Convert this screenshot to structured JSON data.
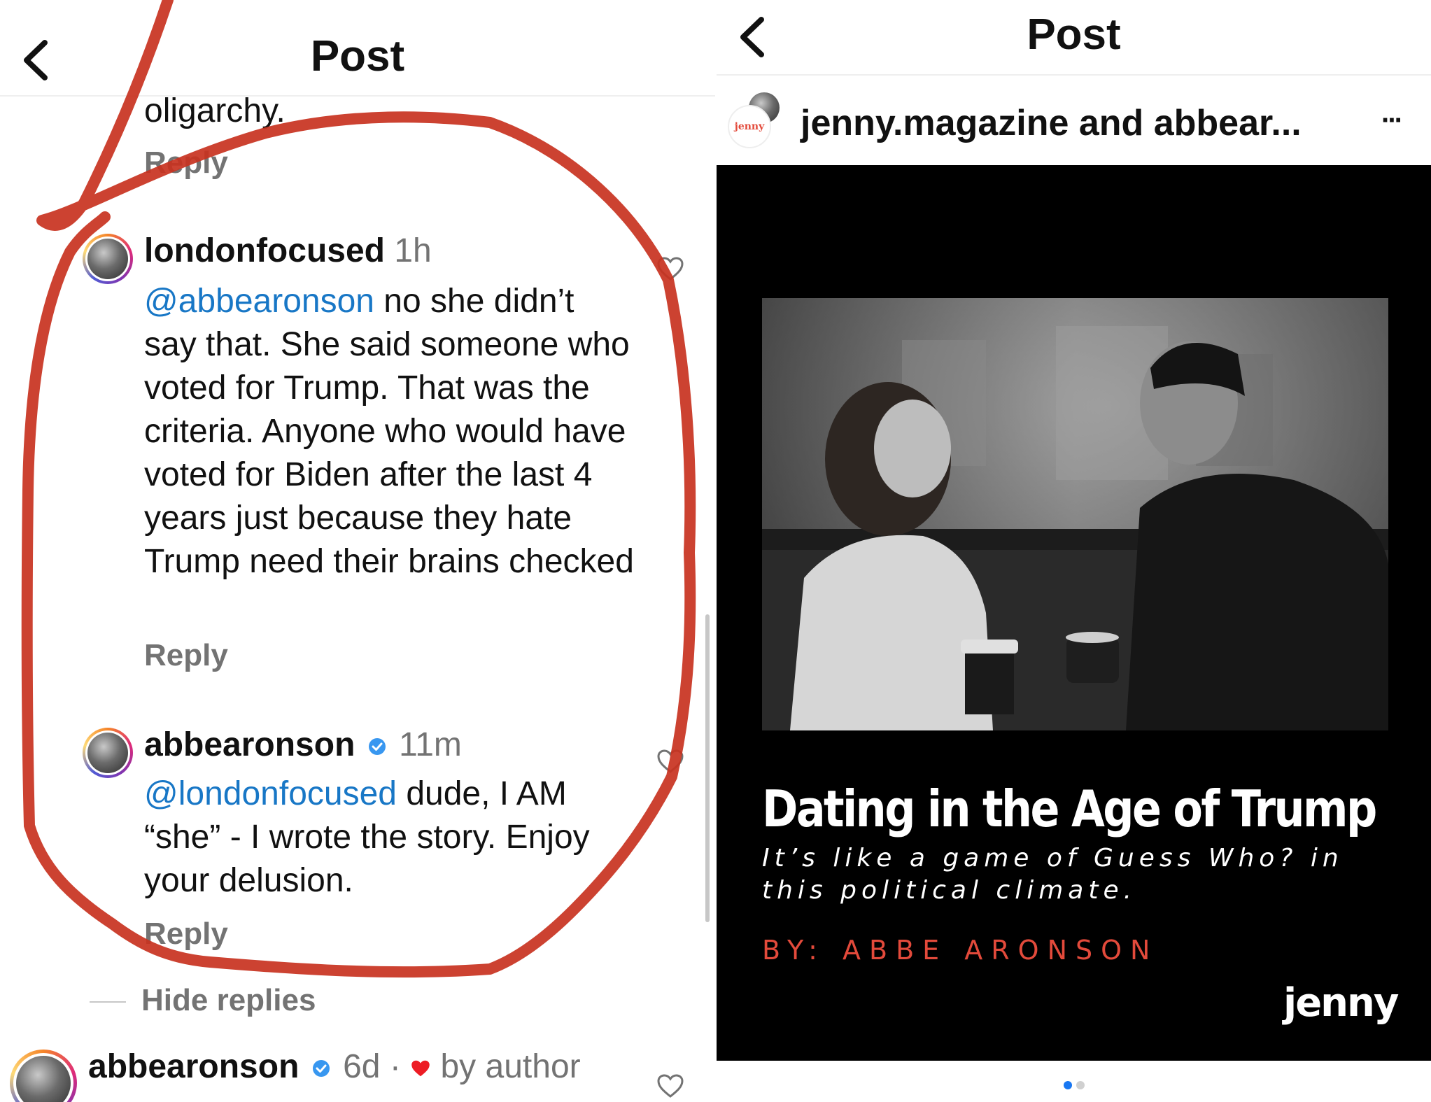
{
  "left": {
    "header": {
      "title": "Post"
    },
    "prev_comment": {
      "tail_text": "oligarchy.",
      "reply_label": "Reply"
    },
    "comment1": {
      "username": "londonfocused",
      "time": "1h",
      "mention": "@abbearonson",
      "text": " no she didn’t say that. She said someone who voted for Trump. That was the criteria. Anyone who would have voted for Biden after the last 4 years just because they hate Trump need their brains checked",
      "reply_label": "Reply"
    },
    "comment2": {
      "username": "abbearonson",
      "time": "11m",
      "mention": "@londonfocused",
      "text": " dude, I AM “she” - I wrote the story. Enjoy your delusion.",
      "reply_label": "Reply"
    },
    "hide_replies_label": "Hide replies",
    "comment3": {
      "username": "abbearonson",
      "time": "6d",
      "separator": "·",
      "liked_by": "by author"
    }
  },
  "right": {
    "header": {
      "title": "Post"
    },
    "post_header": {
      "author_text": "jenny.magazine and abbear...",
      "avatar_label": "jenny",
      "more_label": "···"
    },
    "post_image": {
      "headline": "Dating in the Age of Trump",
      "subline": "It’s like a game of Guess Who? in this political climate.",
      "byline": "BY: ABBE ARONSON",
      "brand": "jenny"
    },
    "carousel": {
      "total": 2,
      "active": 1
    }
  },
  "colors": {
    "mention": "#1877c6",
    "secondary_text": "#737373",
    "verified": "#3897f0",
    "heart_red": "#ed1c24",
    "annotation_red": "#c8321f",
    "byline_red": "#e34a3b",
    "carousel_active": "#1877f2"
  },
  "icons": [
    "back-chevron-icon",
    "heart-outline-icon",
    "verified-badge-icon",
    "heart-filled-icon",
    "more-icon"
  ]
}
